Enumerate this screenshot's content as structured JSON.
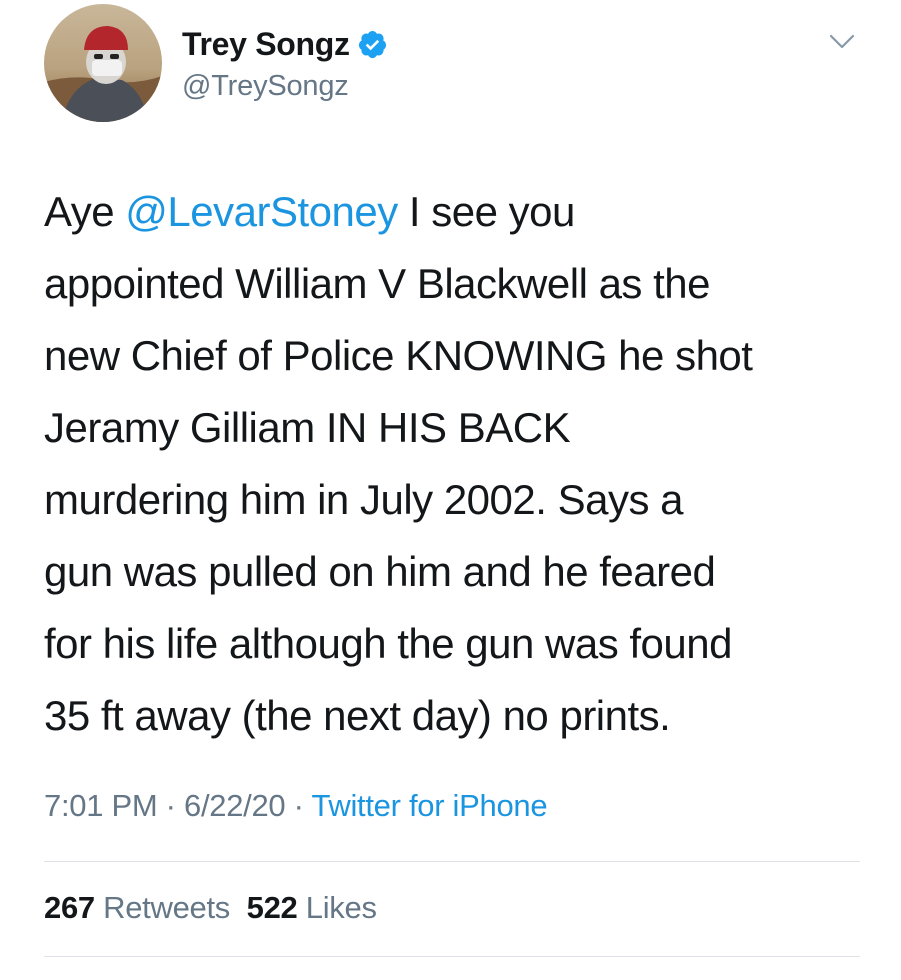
{
  "user": {
    "display_name": "Trey Songz",
    "handle": "@TreySongz",
    "verified": true,
    "avatar_icon": "profile-photo"
  },
  "tweet": {
    "lines": [
      {
        "prefix": "Aye ",
        "mention": "@LevarStoney",
        "suffix": " I see you"
      },
      {
        "text": "appointed William V Blackwell as the"
      },
      {
        "text": "new Chief of Police KNOWING he shot"
      },
      {
        "text": "Jeramy Gilliam IN HIS BACK"
      },
      {
        "text": "murdering him in July 2002. Says a"
      },
      {
        "text": "gun was pulled on him and he feared"
      },
      {
        "text": "for his life although the gun was found"
      },
      {
        "text": "35 ft away (the next day) no prints."
      }
    ]
  },
  "meta": {
    "time": "7:01 PM",
    "sep1": " · ",
    "date": "6/22/20",
    "sep2": " · ",
    "source": "Twitter for iPhone"
  },
  "stats": {
    "retweets_count": "267",
    "retweets_label": "Retweets",
    "likes_count": "522",
    "likes_label": "Likes"
  },
  "colors": {
    "link": "#1b95e0",
    "secondary": "#657786",
    "text": "#14171a",
    "divider": "#dfe3e7"
  }
}
